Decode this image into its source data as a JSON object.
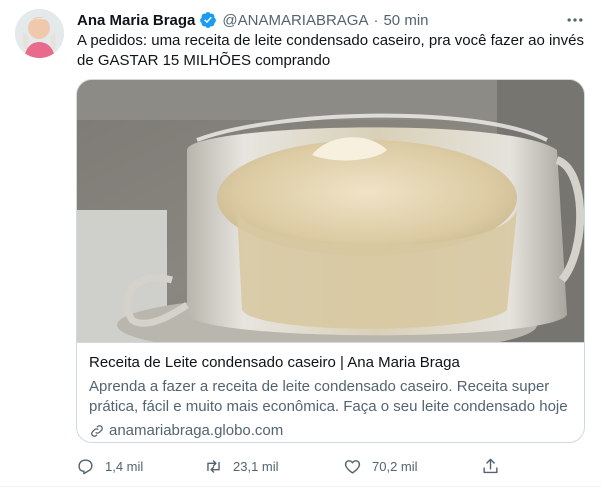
{
  "colors": {
    "accent": "#1d9bf0",
    "text": "#0f1419",
    "secondary": "#536471",
    "border": "#cfd9de"
  },
  "author": {
    "name": "Ana Maria Braga",
    "verified_icon": "verified-badge-icon",
    "handle": "@ANAMARIABRAGA",
    "separator": "·",
    "time": "50 min"
  },
  "tweet": {
    "text_line1": "A pedidos: uma receita de leite condensado caseiro, pra você fazer ao invés",
    "text_line2": "de GASTAR 15 MILHÕES comprando"
  },
  "card": {
    "title": "Receita de Leite condensado caseiro | Ana Maria Braga",
    "description_line1": "Aprenda a fazer a receita de leite condensado caseiro. Receita super",
    "description_line2": "prática, fácil e muito mais econômica. Faça o seu leite condensado hoje ...",
    "domain": "anamariabraga.globo.com"
  },
  "actions": {
    "reply_count": "1,4 mil",
    "retweet_count": "23,1 mil",
    "like_count": "70,2 mil"
  }
}
